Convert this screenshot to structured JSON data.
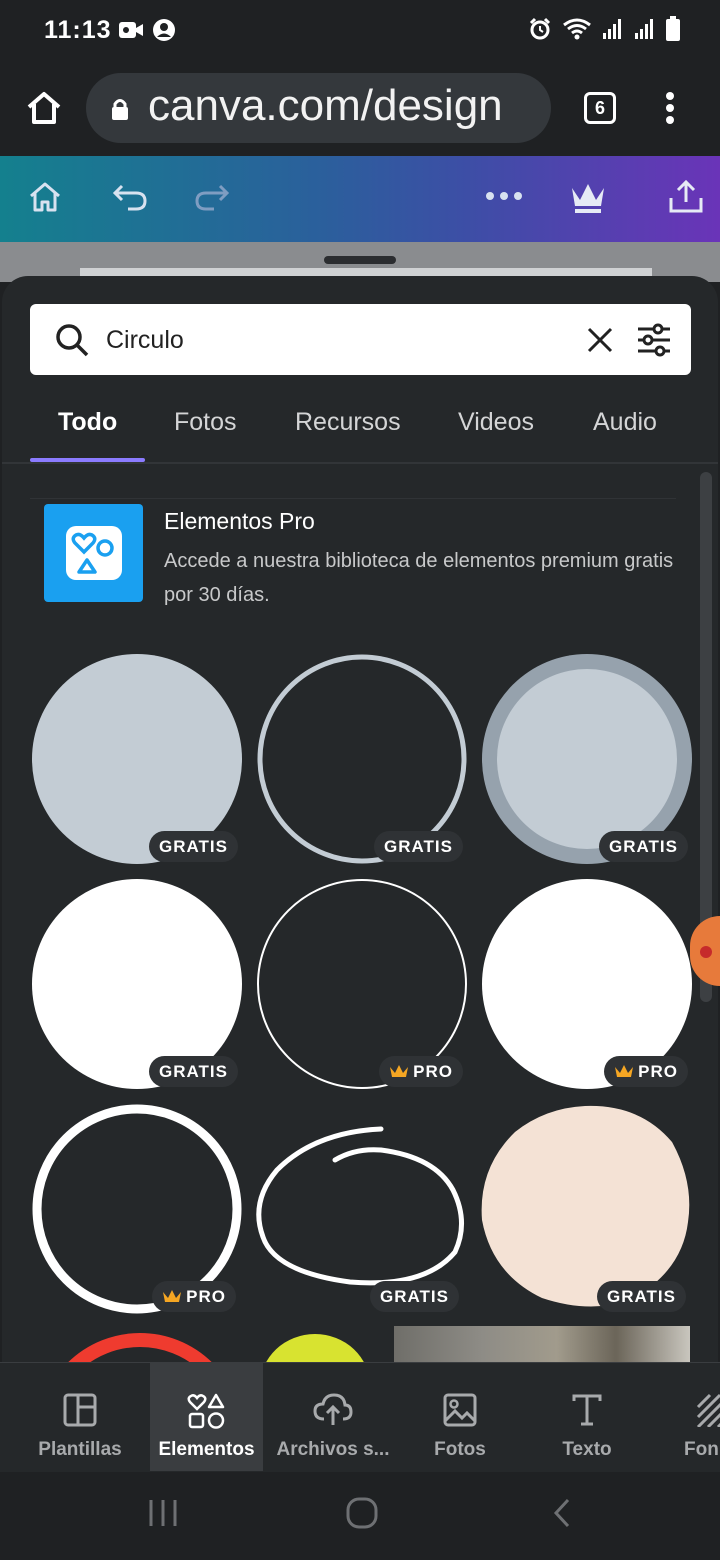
{
  "status_bar": {
    "time": "11:13"
  },
  "browser": {
    "url": "canva.com/design",
    "tab_count": "6"
  },
  "search": {
    "value": "Circulo"
  },
  "tabs": [
    {
      "label": "Todo",
      "active": true
    },
    {
      "label": "Fotos",
      "active": false
    },
    {
      "label": "Recursos",
      "active": false
    },
    {
      "label": "Videos",
      "active": false
    },
    {
      "label": "Audio",
      "active": false
    }
  ],
  "promo": {
    "title": "Elementos Pro",
    "description": "Accede a nuestra biblioteca de elementos premium gratis por 30 días."
  },
  "elements": [
    {
      "type": "filled-circle",
      "badge": "GRATIS",
      "pro": false
    },
    {
      "type": "outline-circle",
      "badge": "GRATIS",
      "pro": false
    },
    {
      "type": "ring-circle",
      "badge": "GRATIS",
      "pro": false
    },
    {
      "type": "white-circle",
      "badge": "GRATIS",
      "pro": false
    },
    {
      "type": "thin-outline-circle",
      "badge": "PRO",
      "pro": true
    },
    {
      "type": "white-circle",
      "badge": "PRO",
      "pro": true
    },
    {
      "type": "thick-outline-circle",
      "badge": "PRO",
      "pro": true
    },
    {
      "type": "hand-drawn-circle",
      "badge": "GRATIS",
      "pro": false
    },
    {
      "type": "textured-circle",
      "badge": "GRATIS",
      "pro": false
    }
  ],
  "bottom_nav": [
    {
      "label": "Plantillas",
      "icon": "templates-icon",
      "active": false
    },
    {
      "label": "Elementos",
      "icon": "elements-icon",
      "active": true
    },
    {
      "label": "Archivos s...",
      "icon": "upload-cloud-icon",
      "active": false
    },
    {
      "label": "Fotos",
      "icon": "photos-icon",
      "active": false
    },
    {
      "label": "Texto",
      "icon": "text-icon",
      "active": false
    },
    {
      "label": "Fon",
      "icon": "background-icon",
      "active": false
    }
  ],
  "colors": {
    "sheet_bg": "#25282a",
    "accent": "#8b7bff",
    "promo_blue": "#1aa0f0",
    "pro_crown": "#f5a623"
  }
}
